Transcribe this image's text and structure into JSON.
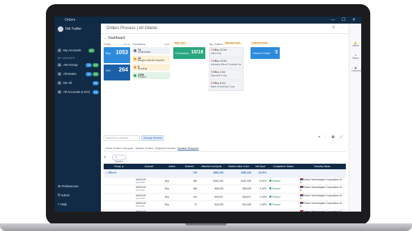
{
  "window": {
    "title": "Orders",
    "controls": "— ☐ ✕"
  },
  "sidebar": {
    "user": "Nik Trafter",
    "section_label": "MY GROUPS",
    "items": [
      {
        "label": "My Accounts",
        "badge": "44",
        "badge2": "",
        "color": "#3aa55d",
        "color2": ""
      },
      {
        "label": "AM Group",
        "badge": "12",
        "badge2": "84",
        "color": "#2e8bdc",
        "color2": "#3aa55d"
      },
      {
        "label": "All Desks",
        "badge": "12",
        "badge2": "84",
        "color": "#2e8bdc",
        "color2": "#3aa55d"
      },
      {
        "label": "EE All",
        "badge": "84",
        "badge2": "",
        "color": "#2e8bdc",
        "color2": ""
      },
      {
        "label": "All Accounts (LGO)",
        "badge": "24",
        "badge2": "",
        "color": "#2e8bdc",
        "color2": ""
      }
    ],
    "bottom": [
      {
        "label": "Preferences"
      },
      {
        "label": "Admin"
      },
      {
        "label": "Help"
      }
    ]
  },
  "header": {
    "title": "Orders Process | All Clients",
    "ctrls": "⟳ ⋯"
  },
  "dashboard": {
    "label": "Dashboard",
    "columns": {
      "orders": "Order",
      "orders_right": "Blend",
      "conditions": "Conditions",
      "conditions_right": "Stale",
      "pending": "Near Syn",
      "top_orders": "Top Orders",
      "top_orders_pill": "Overdue Hold",
      "unseen": "Overdue Hold"
    },
    "order_tiles": [
      {
        "label": "Buy",
        "value": "1053",
        "color": "#2e8bdc"
      },
      {
        "label": "Sell",
        "value": "264",
        "color": "#1a5fa8"
      }
    ],
    "conditions": [
      {
        "n": "74",
        "label": "Unallocated",
        "bg": "#eef1f5",
        "dot": "#6b717a"
      },
      {
        "n": "32",
        "label": "Margin override required",
        "bg": "#fdf1d8",
        "dot": "#e6a23c"
      },
      {
        "n": "4",
        "label": "Blocking",
        "bg": "#fdf1d8",
        "dot": "#e6a23c"
      },
      {
        "n": "1356",
        "label": "Passed",
        "bg": "#e3f3e7",
        "dot": "#3aa55d"
      }
    ],
    "processed": {
      "label": "Processed",
      "value": "10/18"
    },
    "unseen": {
      "label": "Unseen Holds",
      "value": "3"
    },
    "top_orders": [
      {
        "tag": "FAR",
        "name": "Buy 20.0m",
        "sub": "Intel Corp"
      },
      {
        "tag": "FAR",
        "name": "Buy 44.0m",
        "sub": "Advance Micro Products Inc"
      },
      {
        "tag": "FAR",
        "name": "Buy 4.0m",
        "sub": "Microsoft Corp"
      },
      {
        "tag": "FAR",
        "name": "Buy 5.0m",
        "sub": "Bank of America Corp"
      }
    ]
  },
  "filter": {
    "search_placeholder": "Search for a product",
    "chip": "Manage Defaults"
  },
  "tabs": [
    "Client Orders Grouped",
    "Master Orders",
    "Rejected Orders",
    "Symbol Grouped"
  ],
  "active_tab": 3,
  "grouping": {
    "label": "Symbol"
  },
  "table": {
    "headers": [
      "Group ▲",
      "Account",
      "Action",
      "Ordered",
      "Matched Inc/Synth",
      "Market value in $m",
      "Net Qual",
      "Compliance Status",
      "Security Name"
    ],
    "group_row": {
      "group": "2Sho N",
      "ordered": "735",
      "matched": "$382,226",
      "market": "$382,226",
      "net": "19.51%"
    },
    "rows": [
      {
        "account": "0ML5120",
        "account_sub": "Account",
        "action": "Buy",
        "ordered": "165",
        "matched": "$162,290",
        "market": "$162,290",
        "net": "6.91%",
        "status": "Passed",
        "security": "Zebra Technologies Corporation CL A"
      },
      {
        "account": "0ML5120",
        "account_sub": "Account",
        "action": "Buy",
        "ordered": "165",
        "matched": "$38,025",
        "market": "$38,025",
        "net": "3.42%",
        "status": "Passed",
        "security": "Zebra Technologies Corporation CL A"
      },
      {
        "account": "0ML5120",
        "account_sub": "Account",
        "action": "Buy",
        "ordered": "100",
        "matched": "$18,817",
        "market": "$18,817",
        "net": "1.23%",
        "status": "Passed",
        "security": "Zebra Technologies Corporation CL A"
      },
      {
        "account": "0ML5120",
        "account_sub": "Account",
        "action": "Buy",
        "ordered": "70",
        "matched": "$19,330",
        "market": "$19,330",
        "net": "1.30%",
        "status": "Passed",
        "security": "Zebra Technologies Corporation CL A"
      },
      {
        "account": "0ML5120",
        "account_sub": "Account",
        "action": "Buy",
        "ordered": "60",
        "matched": "$19,300",
        "market": "$19,300",
        "net": "1.12%",
        "status": "Passed",
        "security": "Zebra Technologies Corporation CL A"
      },
      {
        "account": "0ML5120",
        "account_sub": "Account",
        "action": "Buy",
        "ordered": "60",
        "matched": "$19,100",
        "market": "$19,100",
        "net": "1.10%",
        "status": "Passed",
        "security": "Zebra Technologies Corporation CL A"
      },
      {
        "account": "0ML5120",
        "account_sub": "Account",
        "action": "Buy",
        "ordered": "45",
        "matched": "$17,300",
        "market": "$17,300",
        "net": "0.98%",
        "status": "Passed",
        "security": "Zebra Technologies Corporation CL A"
      }
    ]
  },
  "right_rail": [
    {
      "label": "Alerts"
    },
    {
      "label": "Filters"
    },
    {
      "label": "Columns"
    }
  ],
  "colors": {
    "brand": "#112b47",
    "accent": "#2e8bdc",
    "processed": "#2aa77f",
    "unseen": "#2e8bdc"
  }
}
